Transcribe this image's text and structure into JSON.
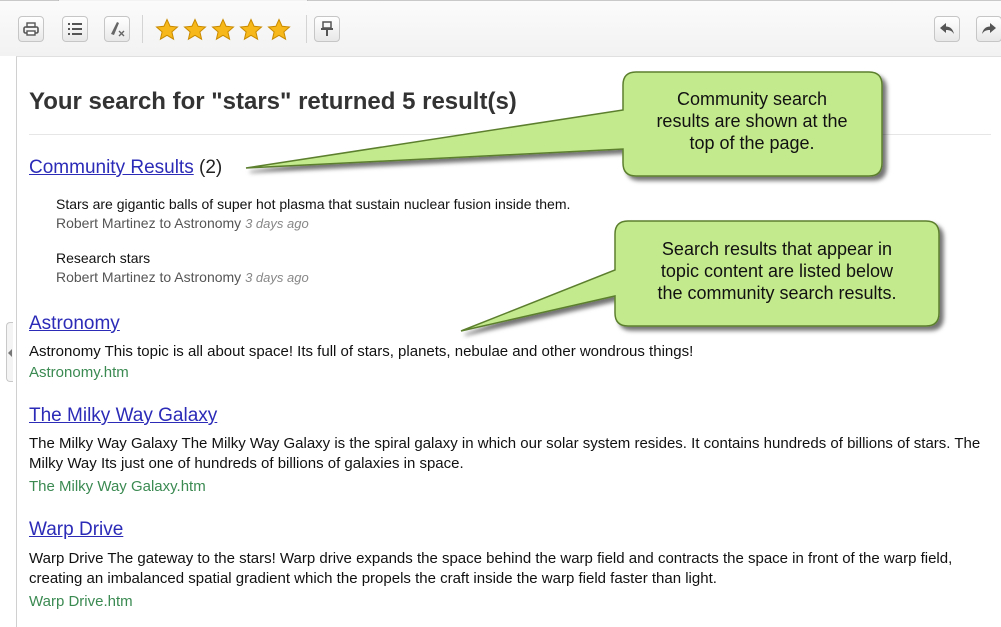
{
  "toolbar": {
    "buttons": [
      {
        "name": "print-icon"
      },
      {
        "name": "list-icon"
      },
      {
        "name": "clear-highlight-icon"
      },
      {
        "name": "pin-icon"
      },
      {
        "name": "back-arrow-icon"
      },
      {
        "name": "forward-arrow-icon"
      }
    ],
    "rating": {
      "stars_filled": 5,
      "stars_total": 5,
      "star_color": "#f6b81a"
    }
  },
  "page": {
    "title": "Your search for \"stars\" returned 5 result(s)"
  },
  "community": {
    "label": "Community Results",
    "count": "(2)",
    "items": [
      {
        "text": "Stars are gigantic balls of super hot plasma that sustain nuclear fusion inside them.",
        "meta": "Robert Martinez to Astronomy",
        "time": "3 days ago"
      },
      {
        "text": "Research stars",
        "meta": "Robert Martinez to Astronomy",
        "time": "3 days ago"
      }
    ]
  },
  "results": [
    {
      "title": "Astronomy",
      "description": "Astronomy This topic is all about space! Its full of stars, planets, nebulae and other wondrous things!",
      "file": "Astronomy.htm"
    },
    {
      "title": "The Milky Way Galaxy",
      "description": "The Milky Way Galaxy The Milky Way Galaxy is the spiral galaxy in which our solar system resides. It contains hundreds of billions of stars. The Milky Way Its just one of hundreds of billions of galaxies in space.",
      "file": "The Milky Way Galaxy.htm"
    },
    {
      "title": "Warp Drive",
      "description": "Warp Drive The gateway to the stars! Warp drive expands the space behind the warp field and contracts the space in front of the warp field, creating an imbalanced spatial gradient which the propels the craft inside the warp field faster than light.",
      "file": "Warp Drive.htm"
    }
  ],
  "callouts": [
    {
      "lines": [
        "Community search",
        "results are shown at the",
        "top of the page."
      ]
    },
    {
      "lines": [
        "Search results that appear in",
        "topic content are listed below",
        "the community search results."
      ]
    }
  ],
  "colors": {
    "link": "#2b2bb8",
    "file": "#3b8a52",
    "callout_fill": "#c4ea8e",
    "callout_border": "#5b7f2e"
  }
}
